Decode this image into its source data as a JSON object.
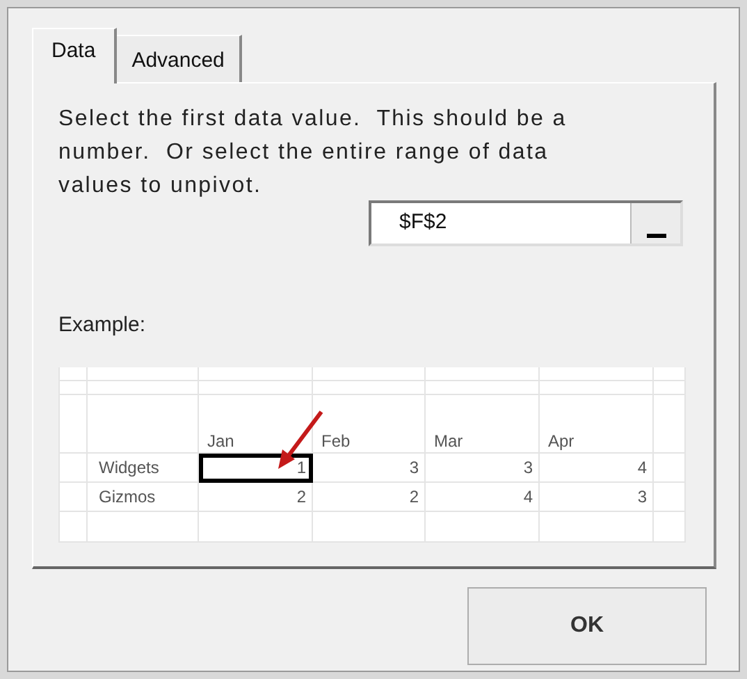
{
  "tabs": [
    {
      "label": "Data",
      "selected": true
    },
    {
      "label": "Advanced",
      "selected": false
    }
  ],
  "instructions": "Select the first data value.  This should be a number.  Or select the entire range of data values to unpivot.",
  "range_field": {
    "value": "$F$2"
  },
  "example": {
    "label": "Example:",
    "columns": [
      "Jan",
      "Feb",
      "Mar",
      "Apr"
    ],
    "rows": [
      {
        "label": "Widgets",
        "values": [
          {
            "text": "1",
            "selected": true
          },
          {
            "text": "3",
            "selected": false
          },
          {
            "text": "3",
            "selected": false
          },
          {
            "text": "4",
            "selected": false
          }
        ]
      },
      {
        "label": "Gizmos",
        "values": [
          {
            "text": "2",
            "selected": false
          },
          {
            "text": "2",
            "selected": false
          },
          {
            "text": "4",
            "selected": false
          },
          {
            "text": "3",
            "selected": false
          }
        ]
      }
    ]
  },
  "ok_button": "OK"
}
